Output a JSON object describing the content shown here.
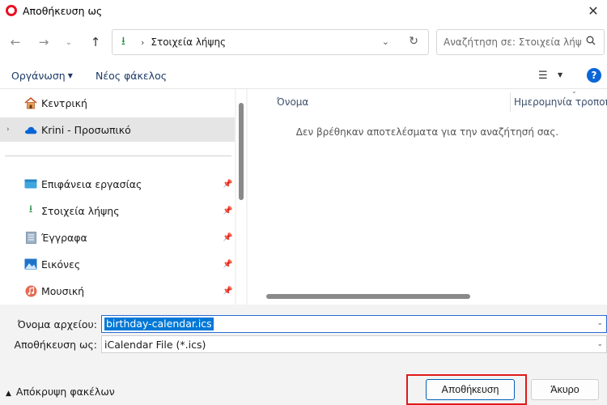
{
  "window": {
    "title": "Αποθήκευση ως"
  },
  "address": {
    "path": "Στοιχεία λήψης"
  },
  "search": {
    "placeholder": "Αναζήτηση σε: Στοιχεία λήψ..."
  },
  "toolbar": {
    "organize": "Οργάνωση",
    "new_folder": "Νέος φάκελος"
  },
  "sidebar": {
    "items": [
      {
        "label": "Κεντρική",
        "icon": "home-icon"
      },
      {
        "label": "Krini - Προσωπικό",
        "icon": "onedrive-cloud-icon"
      },
      {
        "label": "Επιφάνεια εργασίας",
        "icon": "desktop-icon"
      },
      {
        "label": "Στοιχεία λήψης",
        "icon": "download-icon"
      },
      {
        "label": "Έγγραφα",
        "icon": "documents-icon"
      },
      {
        "label": "Εικόνες",
        "icon": "pictures-icon"
      },
      {
        "label": "Μουσική",
        "icon": "music-icon"
      }
    ]
  },
  "columns": {
    "name": "Όνομα",
    "date": "Ημερομηνία τροποποίησης"
  },
  "content": {
    "empty_message": "Δεν βρέθηκαν αποτελέσματα για την αναζήτησή σας."
  },
  "form": {
    "filename_label": "Όνομα αρχείου:",
    "filename_value": "birthday-calendar.ics",
    "filetype_label": "Αποθήκευση ως:",
    "filetype_value": "iCalendar File (*.ics)"
  },
  "footer": {
    "hide_folders": "Απόκρυψη φακέλων",
    "save": "Αποθήκευση",
    "cancel": "Άκυρο"
  },
  "colors": {
    "accent": "#0078d7",
    "highlight": "#e01a1a",
    "link": "#1b3a68"
  }
}
